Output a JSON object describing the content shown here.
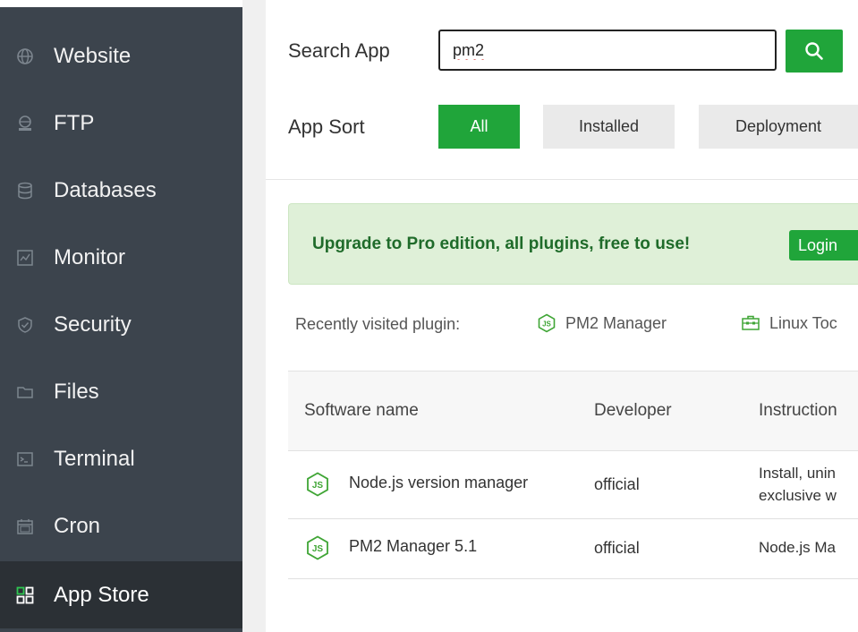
{
  "sidebar": {
    "items": [
      {
        "label": "Website",
        "icon": "globe-icon"
      },
      {
        "label": "FTP",
        "icon": "ftp-icon"
      },
      {
        "label": "Databases",
        "icon": "database-icon"
      },
      {
        "label": "Monitor",
        "icon": "monitor-icon"
      },
      {
        "label": "Security",
        "icon": "shield-icon"
      },
      {
        "label": "Files",
        "icon": "folder-icon"
      },
      {
        "label": "Terminal",
        "icon": "terminal-icon"
      },
      {
        "label": "Cron",
        "icon": "calendar-icon"
      },
      {
        "label": "App Store",
        "icon": "app-grid-icon",
        "active": true
      }
    ]
  },
  "search": {
    "label": "Search App",
    "value": "pm2"
  },
  "sort": {
    "label": "App Sort",
    "options": [
      "All",
      "Installed",
      "Deployment"
    ],
    "selected": "All"
  },
  "banner": {
    "text": "Upgrade to Pro edition, all plugins, free to use!",
    "login_label": "Login"
  },
  "recent": {
    "label": "Recently visited plugin:",
    "items": [
      {
        "label": "PM2 Manager",
        "icon": "nodejs-icon"
      },
      {
        "label": "Linux Toc",
        "icon": "toolbox-icon"
      }
    ]
  },
  "table": {
    "headers": [
      "Software name",
      "Developer",
      "Instruction"
    ],
    "rows": [
      {
        "name": "Node.js version manager",
        "developer": "official",
        "instruction_line1": "Install, unin",
        "instruction_line2": "exclusive w"
      },
      {
        "name": "PM2 Manager 5.1",
        "developer": "official",
        "instruction_line1": "Node.js Ma"
      }
    ]
  },
  "colors": {
    "sidebar_bg": "#3c444d",
    "sidebar_active_bg": "#2b3035",
    "accent_green": "#20a53a",
    "banner_bg": "#dff0d8",
    "banner_text": "#1f6b2a"
  }
}
